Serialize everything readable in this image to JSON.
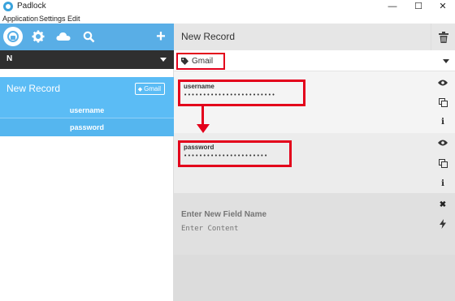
{
  "window": {
    "title": "Padlock",
    "controls": {
      "minimize": "—",
      "maximize": "☐",
      "close": "✕"
    }
  },
  "menu": [
    "Application",
    "Settings",
    "Edit"
  ],
  "toolbar": {
    "icons": [
      "lock-icon",
      "gear-icon",
      "cloud-icon",
      "search-icon",
      "plus-icon"
    ],
    "add_label": "+"
  },
  "filter": {
    "value": "N"
  },
  "record_list": {
    "items": [
      {
        "name": "New Record",
        "tag": "Gmail",
        "fields": [
          "username",
          "password"
        ]
      }
    ]
  },
  "record": {
    "title": "New Record",
    "tag": "Gmail",
    "fields": [
      {
        "name": "username",
        "value": "••••••••••••••••••••••••"
      },
      {
        "name": "password",
        "value": "••••••••••••••••••••••"
      }
    ],
    "new_field": {
      "name_placeholder": "Enter New Field Name",
      "content_placeholder": "Enter Content"
    }
  },
  "colors": {
    "accent": "#59aee6",
    "selection": "#5bbcf5",
    "highlight": "#e3001b",
    "dark_bar": "#2f2f2f"
  }
}
